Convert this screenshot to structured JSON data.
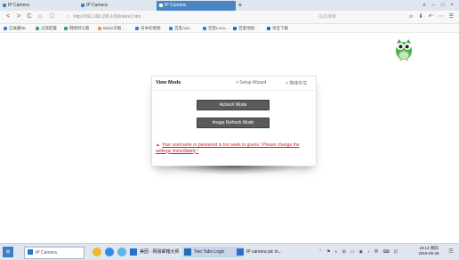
{
  "browser": {
    "tabs": [
      {
        "label": "IP Camera"
      },
      {
        "label": "IP Camera"
      },
      {
        "label": "IP Camera"
      }
    ],
    "new_tab": "+",
    "window_controls": [
      "ʌ",
      "–",
      "□",
      "×"
    ],
    "nav": {
      "back": "<",
      "forward": ">",
      "reload": "C",
      "home": "⌂",
      "sidebar": "□"
    },
    "address": "http://192.168.199.165/index1.htm",
    "search_placeholder": "在此搜索",
    "toolbar_icons": [
      "☆",
      "⬇",
      "↶",
      "⋯",
      "☰"
    ],
    "bookmarks": [
      {
        "label": "已收藏ML",
        "color": "#3b7dd8"
      },
      {
        "label": "过滤配置",
        "color": "#36a86b"
      },
      {
        "label": "网络阿与看",
        "color": "#36a86b"
      },
      {
        "label": "Baiyn识图...",
        "color": "#e0a132"
      },
      {
        "label": "日本的视频",
        "color": "#3b7dd8"
      },
      {
        "label": "百度Aan...",
        "color": "#3b7dd8"
      },
      {
        "label": "百度Loca...",
        "color": "#3b7dd8"
      },
      {
        "label": "百度地图...",
        "color": "#2563c9"
      },
      {
        "label": "淘宝下载",
        "color": "#2563c9"
      }
    ]
  },
  "page": {
    "panel_title": "View Mode",
    "setup_wizard_link": "> Setup Wizard",
    "language_link": "> 简体中文",
    "activex_button": "ActiveX Mode",
    "image_refresh_button": "Image Refresh Mode",
    "warning_icon": "▲",
    "warning_text": "Your username or password is too weak to guess ! Please change the settings immediately !"
  },
  "taskbar": {
    "start_label": "⊞",
    "search_label": "IP Camera",
    "apps": [
      {
        "label": "美团 - 网易邮箱大师",
        "color": "#2b6fc9"
      },
      {
        "label": "Two Tabs Logic",
        "color": "#1f6fb5"
      },
      {
        "label": "IP camera pic in...",
        "color": "#2b6fc9"
      }
    ],
    "tray_icons": [
      "⌃",
      "⚑",
      "◐",
      "⊞",
      "▭",
      "◉",
      "♪",
      "中",
      "⌨",
      "⊡"
    ],
    "time": "19:14 周四",
    "date": "2019-09-26",
    "notification_icon": "☰"
  },
  "colors": {
    "active_tab": "#4a86c5",
    "button": "#5b5b5b",
    "warning": "#d8202a",
    "owl_green": "#49b549"
  }
}
